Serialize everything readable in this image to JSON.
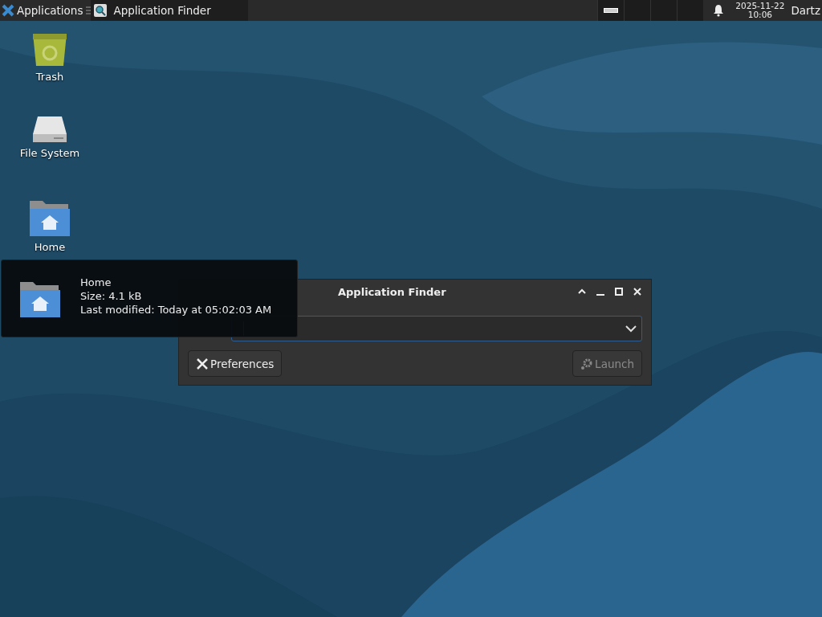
{
  "panel": {
    "applications_menu": "Applications",
    "tasks": [
      {
        "label": "Application Finder",
        "selected": true
      }
    ],
    "clock": {
      "date": "2025-11-22",
      "time": "10:06"
    },
    "user": "Dartz"
  },
  "desktop_icons": [
    {
      "label": "Trash",
      "kind": "trash"
    },
    {
      "label": "File System",
      "kind": "drive"
    },
    {
      "label": "Home",
      "kind": "home"
    }
  ],
  "dialog": {
    "title": "Application Finder",
    "buttons": [
      {
        "label": "Preferences",
        "kind": "preferences",
        "disabled": false
      },
      {
        "label": "Launch",
        "kind": "launch",
        "disabled": true
      }
    ]
  },
  "tooltip": {
    "name": "Home",
    "size": "Size: 4.1 kB",
    "modified": "Last modified: Today at 05:02:03 AM"
  }
}
